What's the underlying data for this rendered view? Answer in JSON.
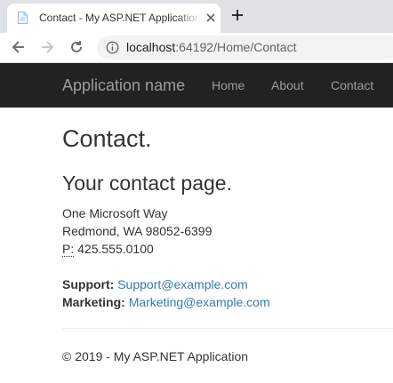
{
  "browser": {
    "tab_title": "Contact - My ASP.NET Application",
    "url_host": "localhost",
    "url_rest": ":64192/Home/Contact"
  },
  "navbar": {
    "brand": "Application name",
    "links": [
      "Home",
      "About",
      "Contact"
    ]
  },
  "main": {
    "title": "Contact.",
    "subtitle": "Your contact page.",
    "address": {
      "line1": "One Microsoft Way",
      "line2": "Redmond, WA 98052-6399",
      "phone_abbr": "P:",
      "phone": "425.555.0100"
    },
    "contacts": [
      {
        "label": "Support:",
        "email": "Support@example.com"
      },
      {
        "label": "Marketing:",
        "email": "Marketing@example.com"
      }
    ]
  },
  "footer": {
    "text": "© 2019 - My ASP.NET Application"
  },
  "colors": {
    "navbar_bg": "#222222",
    "nav_text": "#9d9d9d",
    "link": "#337ab7",
    "tabstrip_bg": "#dee1e6"
  }
}
